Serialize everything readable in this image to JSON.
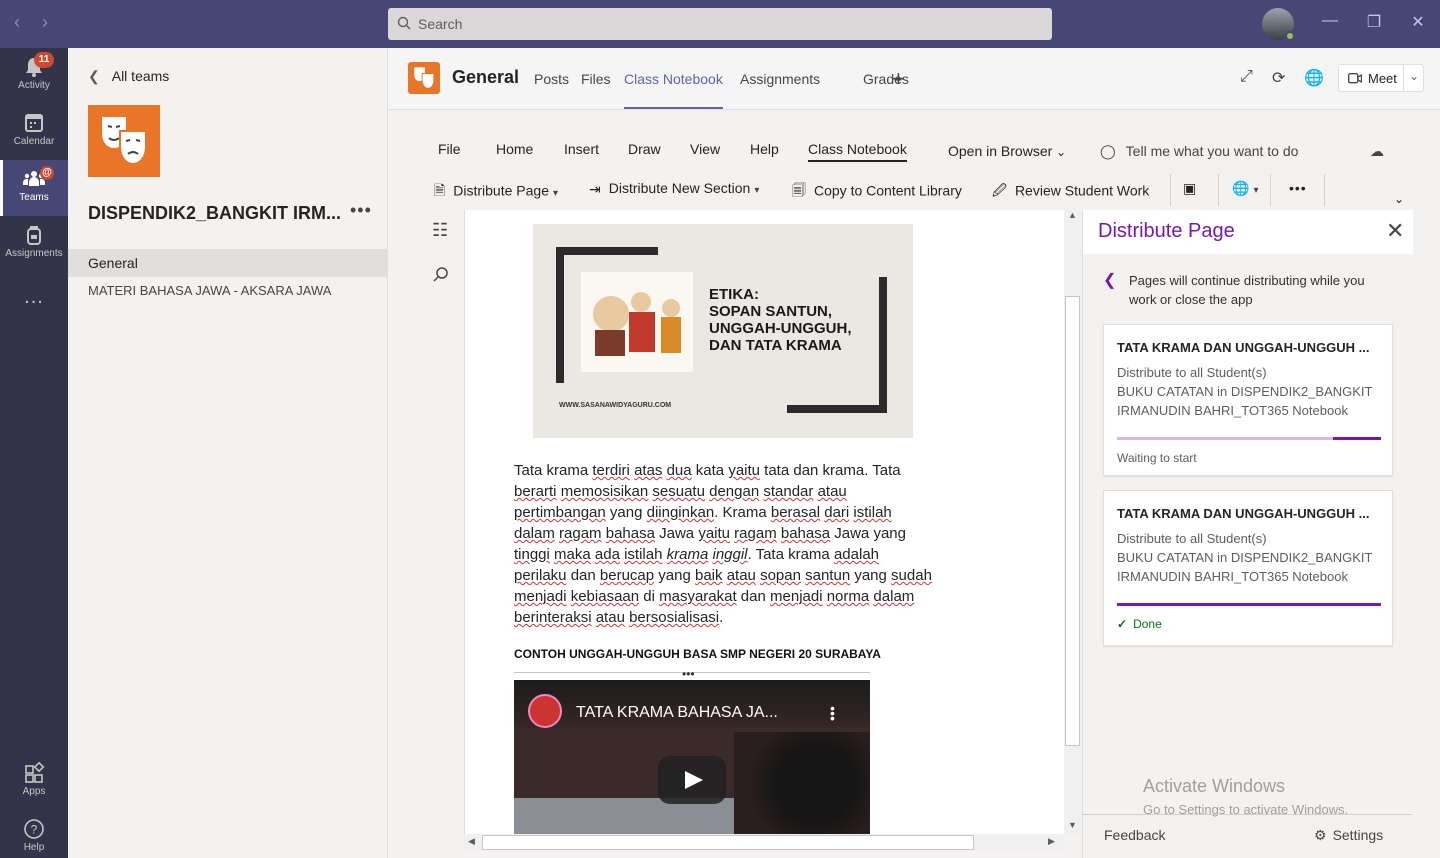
{
  "search": {
    "placeholder": "Search"
  },
  "rail": [
    {
      "label": "Activity",
      "badge": "11",
      "icon": "bell-icon"
    },
    {
      "label": "Calendar",
      "icon": "calendar-icon"
    },
    {
      "label": "Teams",
      "badge": "@",
      "icon": "teams-icon"
    },
    {
      "label": "Assignments",
      "icon": "backpack-icon"
    },
    {
      "label": "...",
      "icon": "more-icon"
    },
    {
      "label": "Apps",
      "icon": "apps-icon"
    },
    {
      "label": "Help",
      "icon": "help-icon"
    }
  ],
  "team_panel": {
    "back_label": "All teams",
    "team_name": "DISPENDIK2_BANGKIT IRM...",
    "channels": [
      "General",
      "MATERI BAHASA JAWA - AKSARA JAWA"
    ]
  },
  "header": {
    "channel": "General",
    "tabs": [
      "Posts",
      "Files",
      "Class Notebook",
      "Assignments",
      "Grades"
    ],
    "meet_label": "Meet"
  },
  "ribbon": {
    "tabs": [
      "File",
      "Home",
      "Insert",
      "Draw",
      "View",
      "Help",
      "Class Notebook",
      "Open in Browser"
    ],
    "tell_me": "Tell me what you want to do",
    "buttons": [
      "Distribute Page",
      "Distribute New Section",
      "Copy to Content Library",
      "Review Student Work"
    ]
  },
  "page": {
    "image_text": "ETIKA:\nSOPAN SANTUN,\nUNGGAH-UNGGUH,\nDAN TATA KRAMA",
    "image_url": "WWW.SASANAWIDYAGURU.COM",
    "heading": "CONTOH UNGGAH-UNGGUH BASA SMP NEGERI 20 SURABAYA",
    "video_title": "TATA KRAMA BAHASA JA..."
  },
  "distribute": {
    "title": "Distribute Page",
    "info": "Pages will continue distributing while you work or close the app",
    "cards": [
      {
        "title": "TATA KRAMA DAN UNGGAH-UNGGUH ...",
        "line1": "Distribute to all Student(s)",
        "line2": "BUKU CATATAN in DISPENDIK2_BANGKIT IRMANUDIN BAHRI_TOT365 Notebook",
        "status": "Waiting to start",
        "progress": 0.82
      },
      {
        "title": "TATA KRAMA DAN UNGGAH-UNGGUH ...",
        "line1": "Distribute to all Student(s)",
        "line2": "BUKU CATATAN in DISPENDIK2_BANGKIT IRMANUDIN BAHRI_TOT365 Notebook",
        "status": "Done",
        "progress": 1.0
      }
    ]
  },
  "watermark": {
    "line1": "Activate Windows",
    "line2": "Go to Settings to activate Windows."
  },
  "footer": {
    "feedback": "Feedback",
    "settings": "Settings"
  }
}
